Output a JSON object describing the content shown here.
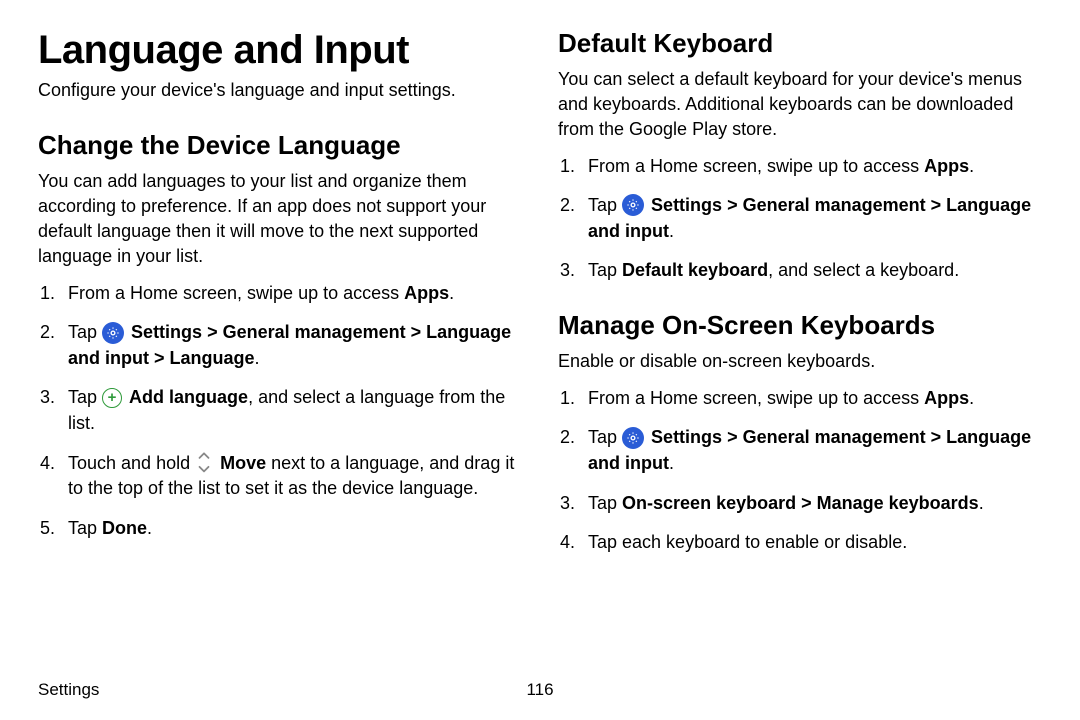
{
  "main_title": "Language and Input",
  "intro": "Configure your device's language and input settings.",
  "footer": {
    "section": "Settings",
    "page": "116"
  },
  "left": {
    "section1": {
      "title": "Change the Device Language",
      "body": "You can add languages to your list and organize them according to preference. If an app does not support your default language then it will move to the next supported language in your list.",
      "steps": {
        "s1_a": "From a Home screen, swipe up to access ",
        "s1_b": "Apps",
        "s1_c": ".",
        "s2_a": "Tap ",
        "s2_b": "Settings",
        "s2_c": " > ",
        "s2_d": "General management",
        "s2_e": "Language and input",
        "s2_f": "Language",
        "s3_a": "Tap ",
        "s3_b": "Add language",
        "s3_c": ", and select a language from the list.",
        "s4_a": "Touch and hold ",
        "s4_b": "Move",
        "s4_c": " next to a language, and drag it to the top of the list to set it as the device language.",
        "s5_a": "Tap ",
        "s5_b": "Done",
        "s5_c": "."
      }
    }
  },
  "right": {
    "section1": {
      "title": "Default Keyboard",
      "body": "You can select a default keyboard for your device's menus and keyboards. Additional keyboards can be downloaded from the Google Play store.",
      "steps": {
        "s1_a": "From a Home screen, swipe up to access ",
        "s1_b": "Apps",
        "s1_c": ".",
        "s2_a": "Tap ",
        "s2_b": "Settings",
        "s2_c": " > ",
        "s2_d": "General management",
        "s2_e": "Language and input",
        "s3_a": "Tap ",
        "s3_b": "Default keyboard",
        "s3_c": ", and select a keyboard."
      }
    },
    "section2": {
      "title": "Manage On-Screen Keyboards",
      "body": "Enable or disable on-screen keyboards.",
      "steps": {
        "s1_a": "From a Home screen, swipe up to access ",
        "s1_b": "Apps",
        "s1_c": ".",
        "s2_a": "Tap ",
        "s2_b": "Settings",
        "s2_c": " > ",
        "s2_d": "General management",
        "s2_e": "Language and input",
        "s3_a": "Tap ",
        "s3_b": "On-screen keyboard",
        "s3_c": " > ",
        "s3_d": "Manage keyboards",
        "s3_e": ".",
        "s4": "Tap each keyboard to enable or disable."
      }
    }
  }
}
